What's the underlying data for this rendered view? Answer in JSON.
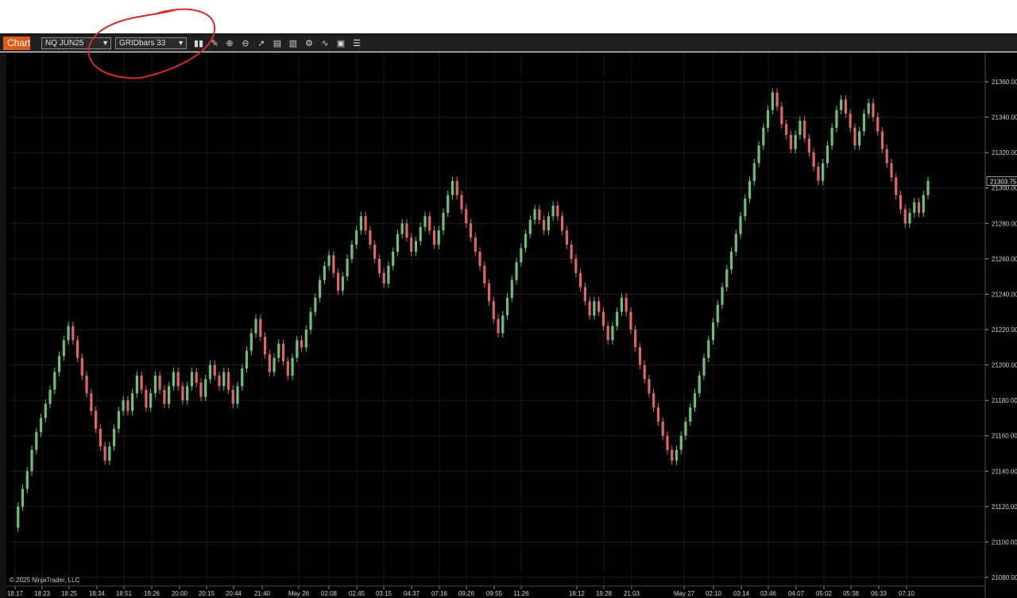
{
  "toolbar": {
    "tab_label": "Chart",
    "instrument": "NQ JUN25",
    "bar_type": "GRIDbars 33"
  },
  "icons": [
    "bars-icon",
    "draw-pencil-icon",
    "zoom-in-icon",
    "zoom-out-icon",
    "pointer-icon",
    "properties-icon",
    "data-box-icon",
    "strategies-icon",
    "indicators-icon",
    "templates-icon",
    "list-icon"
  ],
  "colors": {
    "up": "#6fbf73",
    "down": "#e06666",
    "bg": "#000000",
    "grid": "#222222",
    "annotation": "#d42a2a"
  },
  "footer": {
    "copyright": "© 2025 NinjaTrader, LLC"
  },
  "price_marker": "21303.75",
  "chart_data": {
    "type": "candlestick",
    "title": "",
    "y_ticks": [
      "21360.00",
      "21340.00",
      "21320.00",
      "21300.00",
      "21280.00",
      "21260.00",
      "21240.00",
      "21220.00",
      "21200.00",
      "21180.00",
      "21160.00",
      "21140.00",
      "21120.00",
      "21100.00",
      "21080.00"
    ],
    "ylim": [
      21080,
      21360
    ],
    "x_ticks": [
      "18:17",
      "18:23",
      "18:25",
      "18:34",
      "18:51",
      "19:26",
      "20:00",
      "20:15",
      "20:44",
      "21:40",
      "May 26",
      "02:08",
      "02:45",
      "03:15",
      "04:37",
      "07:16",
      "09:26",
      "09:55",
      "11:26",
      "18:12",
      "19:28",
      "21:03",
      "May 27",
      "02:10",
      "03:14",
      "03:46",
      "04:07",
      "05:02",
      "05:38",
      "06:33",
      "07:10"
    ],
    "path": [
      21108,
      21120,
      21130,
      21140,
      21152,
      21162,
      21170,
      21178,
      21186,
      21196,
      21205,
      21214,
      21222,
      21214,
      21204,
      21194,
      21184,
      21174,
      21164,
      21154,
      21146,
      21154,
      21164,
      21174,
      21180,
      21174,
      21184,
      21194,
      21186,
      21176,
      21184,
      21194,
      21186,
      21178,
      21188,
      21196,
      21188,
      21180,
      21188,
      21196,
      21190,
      21182,
      21192,
      21200,
      21194,
      21188,
      21196,
      21186,
      21178,
      21188,
      21198,
      21208,
      21218,
      21226,
      21216,
      21206,
      21196,
      21204,
      21212,
      21202,
      21194,
      21204,
      21214,
      21210,
      21220,
      21230,
      21238,
      21248,
      21256,
      21262,
      21252,
      21242,
      21250,
      21260,
      21268,
      21276,
      21284,
      21276,
      21268,
      21260,
      21252,
      21246,
      21256,
      21264,
      21274,
      21280,
      21272,
      21264,
      21270,
      21278,
      21284,
      21276,
      21268,
      21276,
      21286,
      21296,
      21304,
      21296,
      21288,
      21280,
      21272,
      21264,
      21256,
      21246,
      21236,
      21226,
      21218,
      21228,
      21238,
      21248,
      21258,
      21266,
      21274,
      21282,
      21288,
      21282,
      21276,
      21284,
      21290,
      21284,
      21276,
      21268,
      21260,
      21252,
      21244,
      21236,
      21228,
      21236,
      21230,
      21222,
      21214,
      21222,
      21230,
      21238,
      21230,
      21220,
      21210,
      21200,
      21192,
      21184,
      21176,
      21168,
      21160,
      21152,
      21146,
      21152,
      21160,
      21168,
      21176,
      21184,
      21194,
      21204,
      21214,
      21224,
      21234,
      21244,
      21254,
      21264,
      21274,
      21284,
      21294,
      21304,
      21314,
      21324,
      21334,
      21344,
      21354,
      21346,
      21336,
      21330,
      21322,
      21330,
      21338,
      21328,
      21320,
      21312,
      21304,
      21314,
      21324,
      21334,
      21344,
      21350,
      21342,
      21334,
      21324,
      21332,
      21342,
      21348,
      21340,
      21332,
      21322,
      21314,
      21306,
      21296,
      21288,
      21280,
      21286,
      21292,
      21286,
      21296,
      21304
    ]
  },
  "annotation": "red-circle-around-bar-type-selector"
}
